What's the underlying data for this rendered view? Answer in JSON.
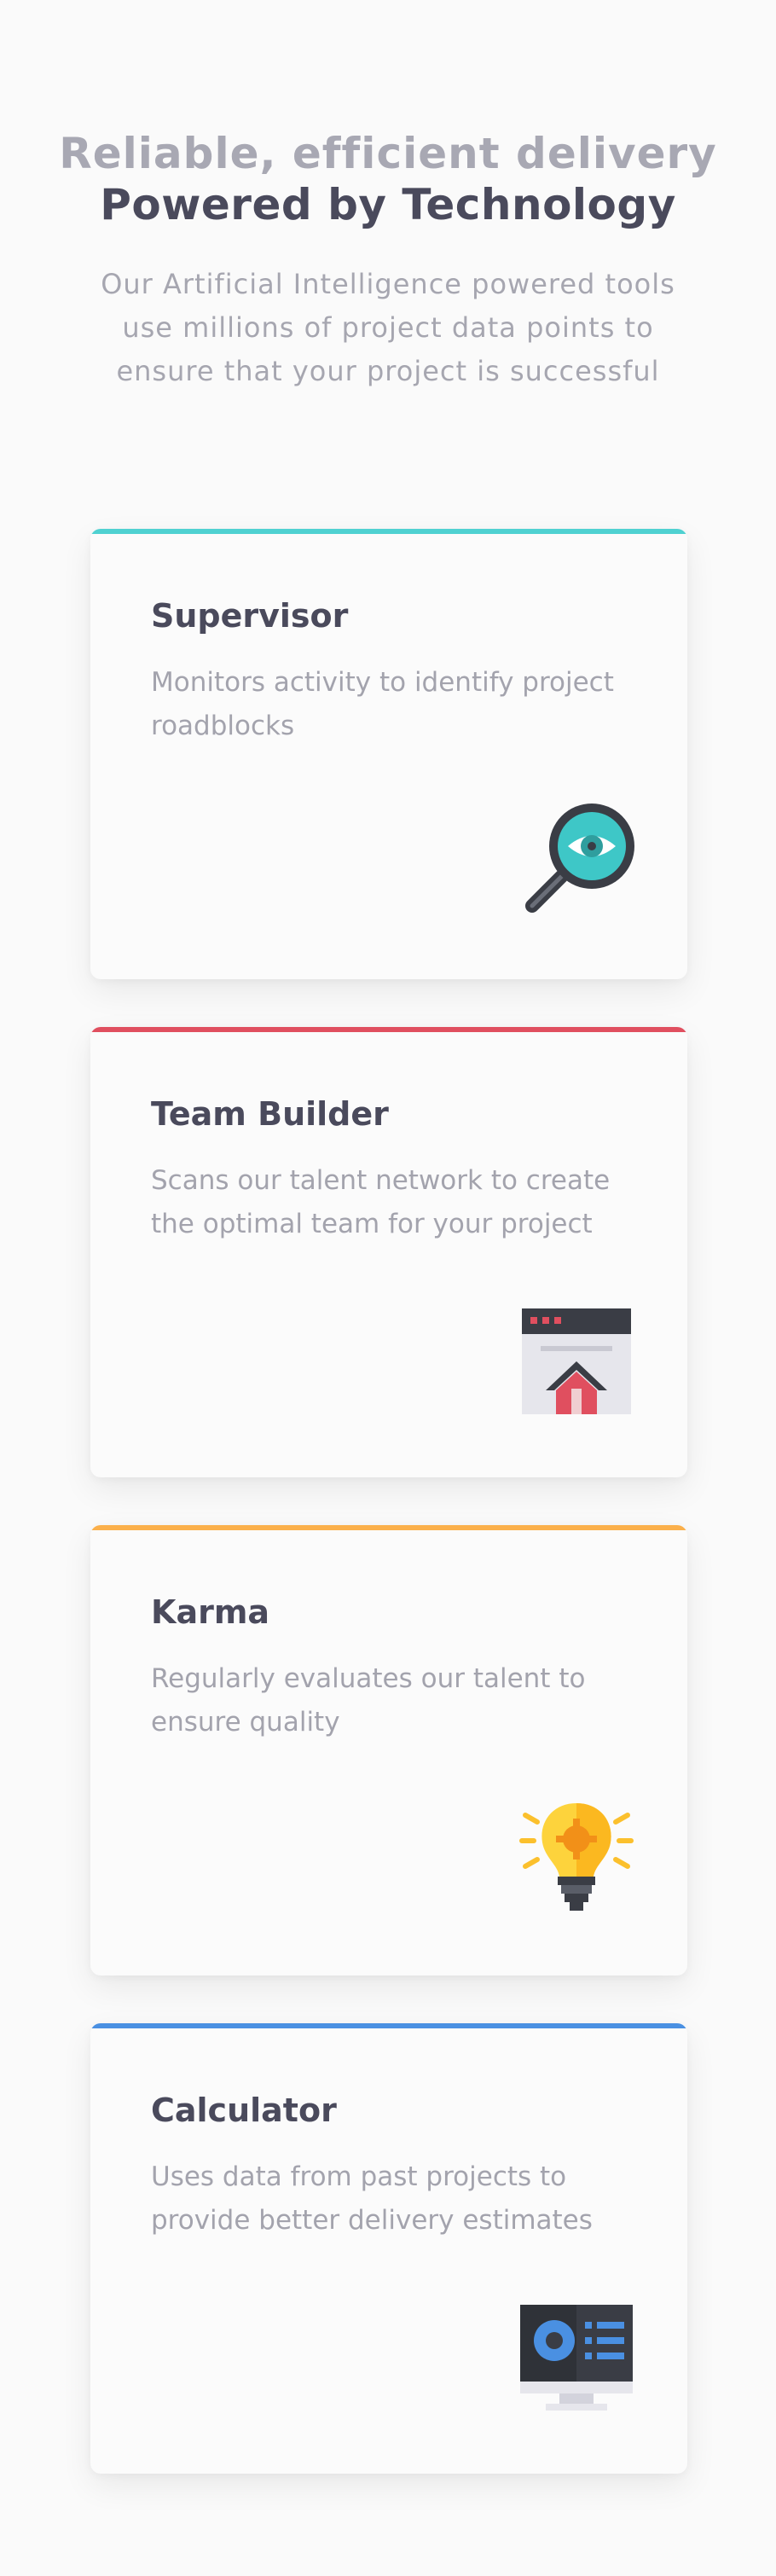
{
  "header": {
    "title_line1": "Reliable, efficient delivery",
    "title_line2": "Powered by Technology",
    "subtitle": "Our Artificial Intelligence powered tools use millions of project data points to ensure that your project is successful"
  },
  "cards": [
    {
      "title": "Supervisor",
      "description": "Monitors activity to identify project roadblocks",
      "accent_color": "#4fd1d1",
      "icon": "magnifier-eye-icon"
    },
    {
      "title": "Team Builder",
      "description": "Scans our talent network to create the optimal team for your project",
      "accent_color": "#e04f5f",
      "icon": "browser-house-icon"
    },
    {
      "title": "Karma",
      "description": "Regularly evaluates our talent to ensure quality",
      "accent_color": "#fbb04b",
      "icon": "lightbulb-gear-icon"
    },
    {
      "title": "Calculator",
      "description": "Uses data from past projects to provide better delivery estimates",
      "accent_color": "#4a90e2",
      "icon": "monitor-profile-icon"
    }
  ]
}
